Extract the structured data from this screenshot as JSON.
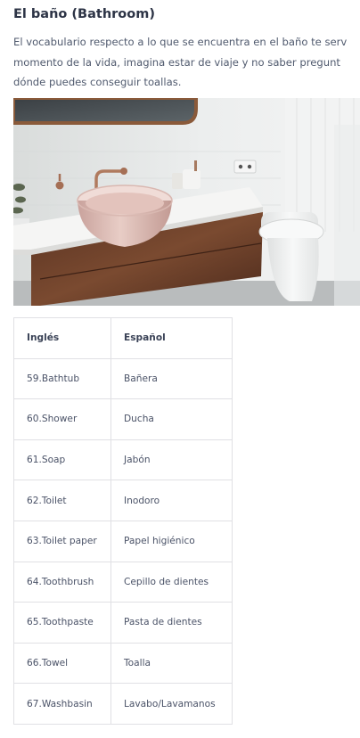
{
  "section": {
    "title": "El baño (Bathroom)",
    "intro_lines": [
      "El vocabulario respecto a lo que se encuentra en el baño te serv",
      "momento de la vida, imagina estar de viaje y no saber pregunt",
      "dónde puedes conseguir toallas."
    ]
  },
  "image": {
    "subject": "bathroom-photo"
  },
  "table": {
    "headers": [
      "Inglés",
      "Español"
    ],
    "rows": [
      [
        "59.Bathtub",
        "Bañera"
      ],
      [
        "60.Shower",
        "Ducha"
      ],
      [
        "61.Soap",
        "Jabón"
      ],
      [
        "62.Toilet",
        "Inodoro"
      ],
      [
        "63.Toilet paper",
        "Papel higiénico"
      ],
      [
        "64.Toothbrush",
        "Cepillo de dientes"
      ],
      [
        "65.Toothpaste",
        "Pasta de dientes"
      ],
      [
        "66.Towel",
        "Toalla"
      ],
      [
        "67.Washbasin",
        "Lavabo/Lavamanos"
      ]
    ]
  }
}
